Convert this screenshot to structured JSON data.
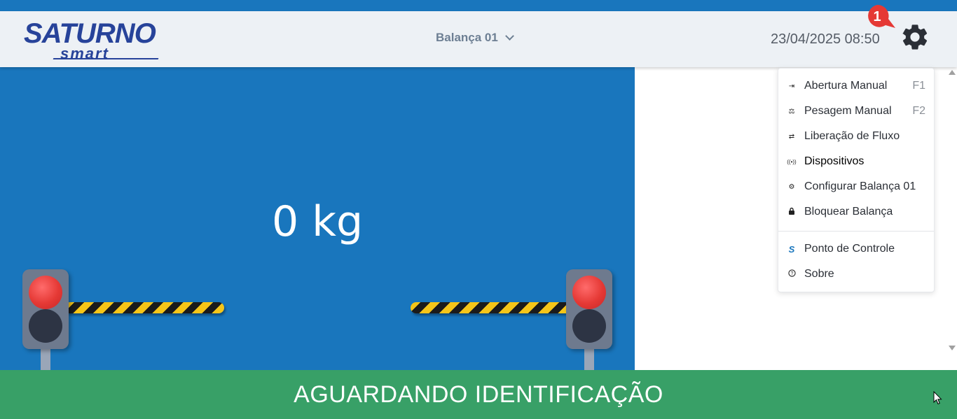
{
  "header": {
    "logo_text_top": "SATURNO",
    "logo_text_bottom": "smart",
    "scale_selector": "Balança 01",
    "datetime": "23/04/2025 08:50",
    "notification_count": "1",
    "settings_icon": "gear-icon"
  },
  "scale": {
    "weight": "0 kg",
    "left_light": "red",
    "right_light": "red"
  },
  "menu": {
    "items": [
      {
        "icon": "enter-icon",
        "glyph": "⇥",
        "label": "Abertura Manual",
        "shortcut": "F1"
      },
      {
        "icon": "scale-icon",
        "glyph": "⚖",
        "label": "Pesagem Manual",
        "shortcut": "F2"
      },
      {
        "icon": "swap-icon",
        "glyph": "⇄",
        "label": "Liberação de Fluxo",
        "shortcut": ""
      },
      {
        "icon": "broadcast-icon",
        "glyph": "((•))",
        "label": "Dispositivos",
        "shortcut": ""
      },
      {
        "icon": "settings-icon",
        "glyph": "⚙",
        "label": "Configurar Balança 01",
        "shortcut": ""
      },
      {
        "icon": "lock-icon",
        "glyph": "🔒",
        "label": "Bloquear Balança",
        "shortcut": ""
      },
      {
        "icon": "saturno-s-icon",
        "glyph": "S",
        "label": "Ponto de Controle",
        "shortcut": ""
      },
      {
        "icon": "help-icon",
        "glyph": "?",
        "label": "Sobre",
        "shortcut": ""
      }
    ]
  },
  "status": {
    "text": "AGUARDANDO IDENTIFICAÇÃO"
  },
  "colors": {
    "primary_blue": "#1976bd",
    "status_green": "#38a067",
    "badge_red": "#e53935"
  }
}
